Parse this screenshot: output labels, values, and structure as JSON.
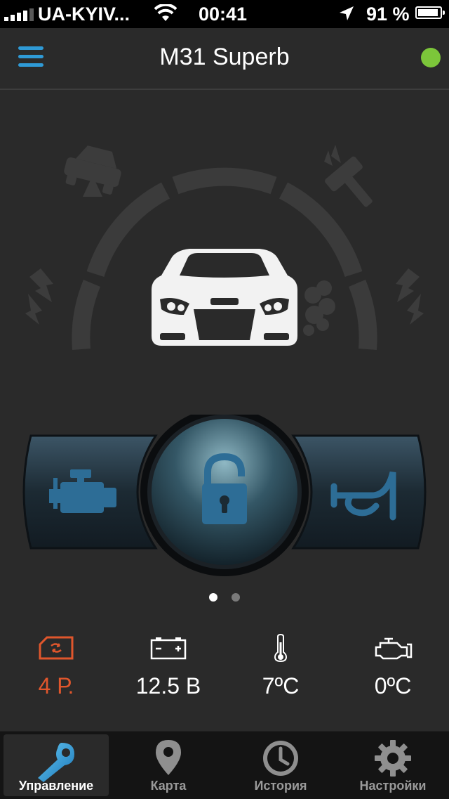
{
  "status_bar": {
    "carrier": "UA-KYIV...",
    "time": "00:41",
    "battery": "91 %"
  },
  "header": {
    "title": "M31 Superb",
    "connection_color": "#7cc63a"
  },
  "colors": {
    "accent": "#2f9ad6",
    "alert": "#e0562c",
    "button_icon": "#2d6d96"
  },
  "pager": {
    "pages": 2,
    "active": 1
  },
  "sensors": [
    {
      "name": "gsm-balance",
      "value": "4 Р.",
      "color": "#e0562c"
    },
    {
      "name": "battery",
      "value": "12.5 В",
      "color": "#ffffff"
    },
    {
      "name": "temperature",
      "value": "7ºC",
      "color": "#ffffff"
    },
    {
      "name": "engine-temperature",
      "value": "0ºC",
      "color": "#ffffff"
    }
  ],
  "tabs": [
    {
      "label": "Управление",
      "icon": "key-icon",
      "active": true
    },
    {
      "label": "Карта",
      "icon": "map-pin-icon",
      "active": false
    },
    {
      "label": "История",
      "icon": "clock-icon",
      "active": false
    },
    {
      "label": "Настройки",
      "icon": "gear-icon",
      "active": false
    }
  ]
}
